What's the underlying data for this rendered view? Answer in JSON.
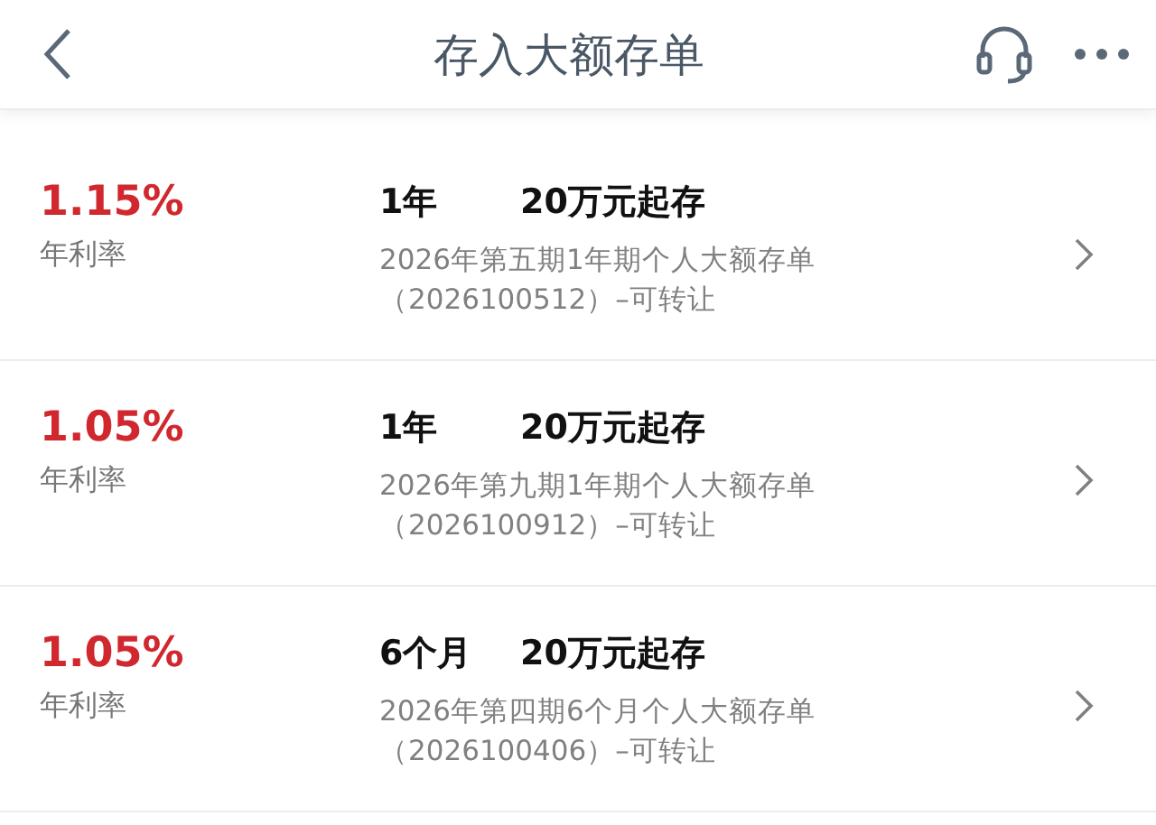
{
  "header": {
    "title": "存入大额存单"
  },
  "products": [
    {
      "rate": "1.15%",
      "rate_label": "年利率",
      "term": "1年",
      "minimum": "20万元起存",
      "name": "2026年第五期1年期个人大额存单",
      "code": "（2026100512）–可转让"
    },
    {
      "rate": "1.05%",
      "rate_label": "年利率",
      "term": "1年",
      "minimum": "20万元起存",
      "name": "2026年第九期1年期个人大额存单",
      "code": "（2026100912）–可转让"
    },
    {
      "rate": "1.05%",
      "rate_label": "年利率",
      "term": "6个月",
      "minimum": "20万元起存",
      "name": "2026年第四期6个月个人大额存单",
      "code": "（2026100406）–可转让"
    }
  ]
}
